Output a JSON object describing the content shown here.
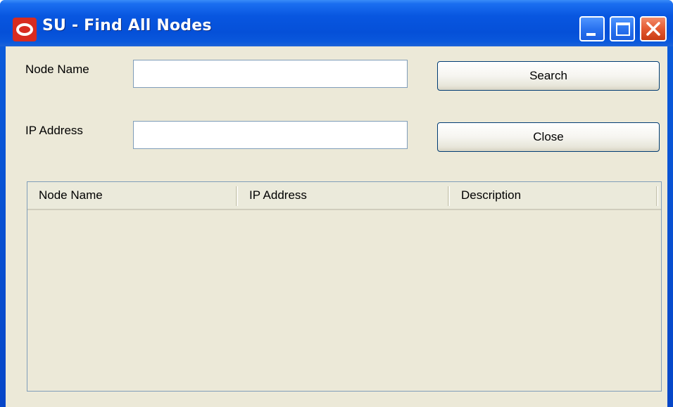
{
  "window": {
    "title": "SU - Find All Nodes",
    "controls": {
      "minimize": "minimize-icon",
      "maximize": "maximize-icon",
      "close": "close-icon"
    },
    "icon": "oracle-logo-icon"
  },
  "form": {
    "node_name_label": "Node Name",
    "node_name_value": "",
    "ip_address_label": "IP Address",
    "ip_address_value": ""
  },
  "buttons": {
    "search_label": "Search",
    "close_label": "Close"
  },
  "results_table": {
    "columns": [
      "Node Name",
      "IP Address",
      "Description"
    ],
    "rows": []
  },
  "colors": {
    "titlebar": "#0554dc",
    "client_background": "#ece9d8",
    "input_border": "#7f9db9",
    "button_border": "#003c74",
    "close_button": "#e45a32",
    "app_icon": "#d82c20"
  }
}
